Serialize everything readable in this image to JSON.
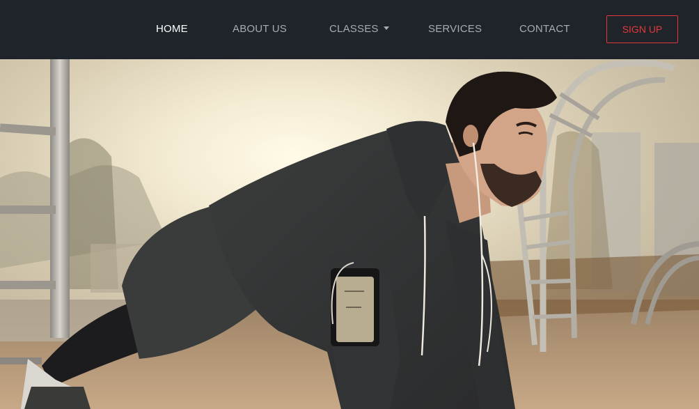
{
  "nav": {
    "items": [
      {
        "label": "HOME",
        "active": true
      },
      {
        "label": "ABOUT US",
        "active": false
      },
      {
        "label": "CLASSES",
        "active": false,
        "has_dropdown": true
      },
      {
        "label": "SERVICES",
        "active": false
      },
      {
        "label": "CONTACT",
        "active": false
      }
    ],
    "signup_label": "SIGN UP"
  },
  "colors": {
    "nav_bg": "#1f232a",
    "nav_text": "#a7abb3",
    "nav_active": "#ffffff",
    "accent": "#e5383b"
  },
  "hero": {
    "image_subject": "man-doing-push-up-outdoors"
  }
}
